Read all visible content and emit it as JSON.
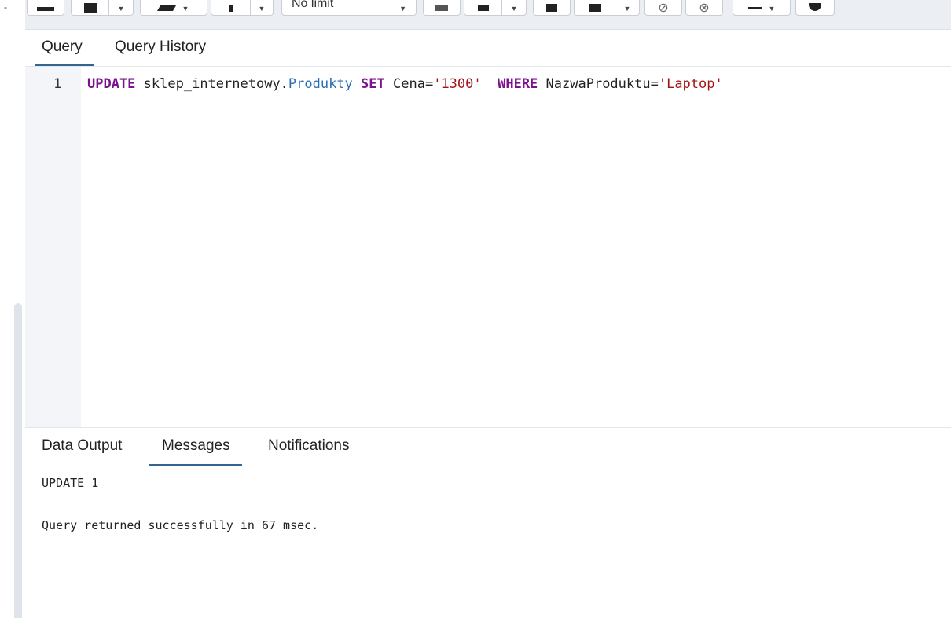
{
  "toolbar": {
    "limit_select": "No limit",
    "corner_mark": "-"
  },
  "query_tabs": [
    {
      "label": "Query",
      "active": true
    },
    {
      "label": "Query History",
      "active": false
    }
  ],
  "editor": {
    "line_number": "1",
    "tokens": {
      "kw_update": "UPDATE",
      "schema": "sklep_internetowy.",
      "table": "Produkty",
      "kw_set": "SET",
      "col1": "Cena=",
      "val1": "'1300'",
      "kw_where": "WHERE",
      "col2": "NazwaProduktu=",
      "val2": "'Laptop'"
    }
  },
  "output_tabs": [
    {
      "label": "Data Output",
      "active": false
    },
    {
      "label": "Messages",
      "active": true
    },
    {
      "label": "Notifications",
      "active": false
    }
  ],
  "messages": {
    "line1": "UPDATE 1",
    "line2": "Query returned successfully in 67 msec."
  },
  "colors": {
    "keyword": "#7d1290",
    "table": "#2a6fb2",
    "string": "#a31515",
    "active_tab_underline": "#326690"
  }
}
